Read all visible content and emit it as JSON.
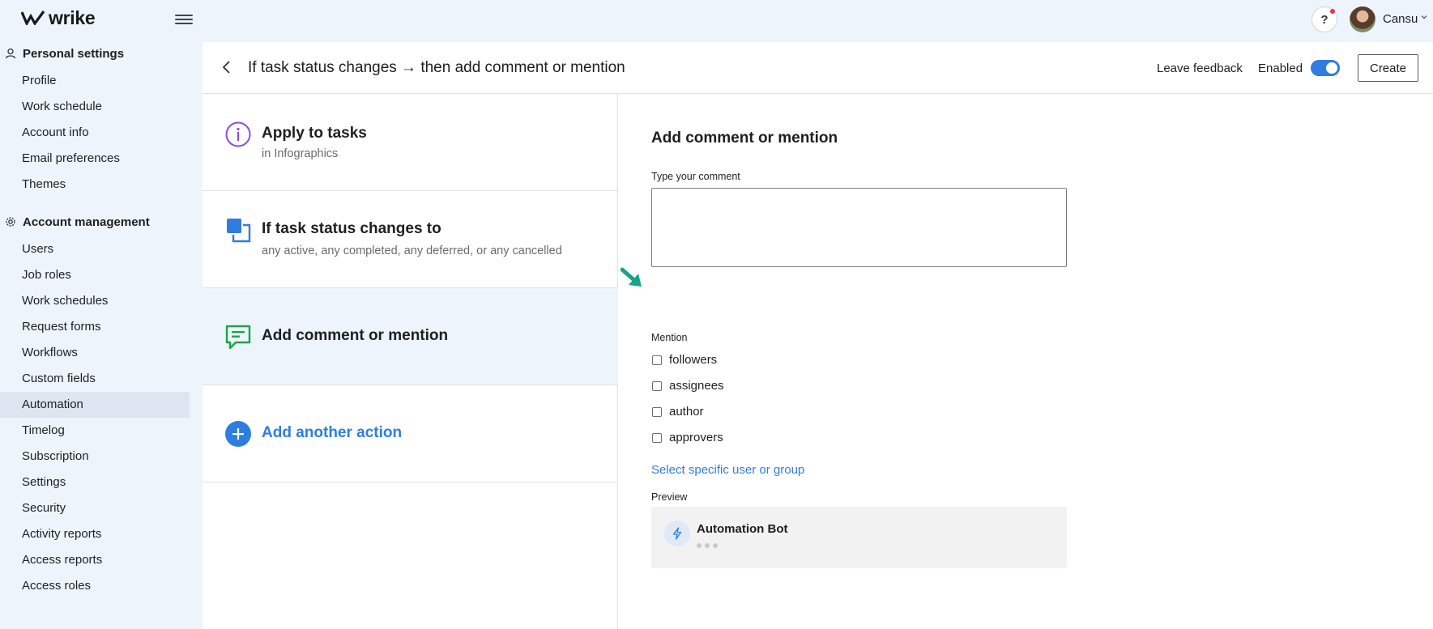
{
  "app": {
    "logo_text": "wrike"
  },
  "user": {
    "name": "Cansu"
  },
  "sidebar": {
    "personal_section": "Personal settings",
    "personal_items": [
      "Profile",
      "Work schedule",
      "Account info",
      "Email preferences",
      "Themes"
    ],
    "account_section": "Account management",
    "account_items": [
      "Users",
      "Job roles",
      "Work schedules",
      "Request forms",
      "Workflows",
      "Custom fields",
      "Automation",
      "Timelog",
      "Subscription",
      "Settings",
      "Security",
      "Activity reports",
      "Access reports",
      "Access roles"
    ],
    "active_item": "Automation"
  },
  "header": {
    "title": "If task status changes → then add comment or mention",
    "feedback_label": "Leave feedback",
    "enabled_label": "Enabled",
    "enabled": true,
    "create_label": "Create"
  },
  "steps": [
    {
      "title": "Apply to tasks",
      "subtitle": "in Infographics",
      "icon": "info-icon"
    },
    {
      "title": "If task status changes to",
      "subtitle": "any active, any completed, any deferred, or any cancelled",
      "icon": "status-change-icon"
    },
    {
      "title": "Add comment or mention",
      "subtitle": "",
      "icon": "comment-icon",
      "selected": true
    },
    {
      "title": "Add another action",
      "subtitle": "",
      "icon": "plus-circle-icon"
    }
  ],
  "detail": {
    "title": "Add comment or mention",
    "comment_label": "Type your comment",
    "comment_value": "",
    "mention_label": "Mention",
    "mention_options": [
      {
        "label": "followers",
        "checked": false
      },
      {
        "label": "assignees",
        "checked": false
      },
      {
        "label": "author",
        "checked": false
      },
      {
        "label": "approvers",
        "checked": false
      }
    ],
    "select_link": "Select specific user or group",
    "preview_label": "Preview",
    "preview_bot_name": "Automation Bot"
  },
  "colors": {
    "accent": "#2f7de1",
    "sidebar_bg": "#edf4fc",
    "comment_icon": "#1aa34a",
    "info_icon": "#8a4fd8",
    "arrow": "#17a589"
  }
}
